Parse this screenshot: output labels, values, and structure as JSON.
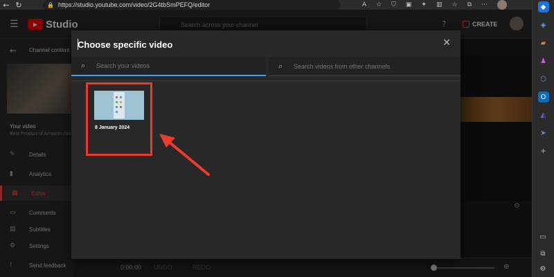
{
  "browser": {
    "url": "https://studio.youtube.com/video/2G4tbSmPEFQ/editor",
    "back_icon": "back-arrow-icon",
    "refresh_icon": "refresh-icon"
  },
  "header": {
    "studio_label": "Studio",
    "search_placeholder": "Search across your channel",
    "create_label": "CREATE"
  },
  "sidebar": {
    "channel_content": "Channel content",
    "your_video": "Your video",
    "video_subtitle": "Best Product of Amazon.com",
    "items": [
      {
        "label": "Details",
        "icon": "pencil-icon"
      },
      {
        "label": "Analytics",
        "icon": "chart-icon"
      },
      {
        "label": "Editor",
        "icon": "film-icon"
      },
      {
        "label": "Comments",
        "icon": "comment-icon"
      },
      {
        "label": "Subtitles",
        "icon": "subtitles-icon"
      },
      {
        "label": "Settings",
        "icon": "gear-icon"
      },
      {
        "label": "Send feedback",
        "icon": "feedback-icon"
      }
    ]
  },
  "editor": {
    "time": "0:00:00",
    "undo": "UNDO",
    "redo": "REDO"
  },
  "modal": {
    "title": "Choose specific video",
    "search_own_placeholder": "Search your videos",
    "search_other_placeholder": "Search videos from other channels",
    "videos": [
      {
        "date": "8 January 2024"
      }
    ],
    "highlight_color": "#ee3a2a"
  }
}
